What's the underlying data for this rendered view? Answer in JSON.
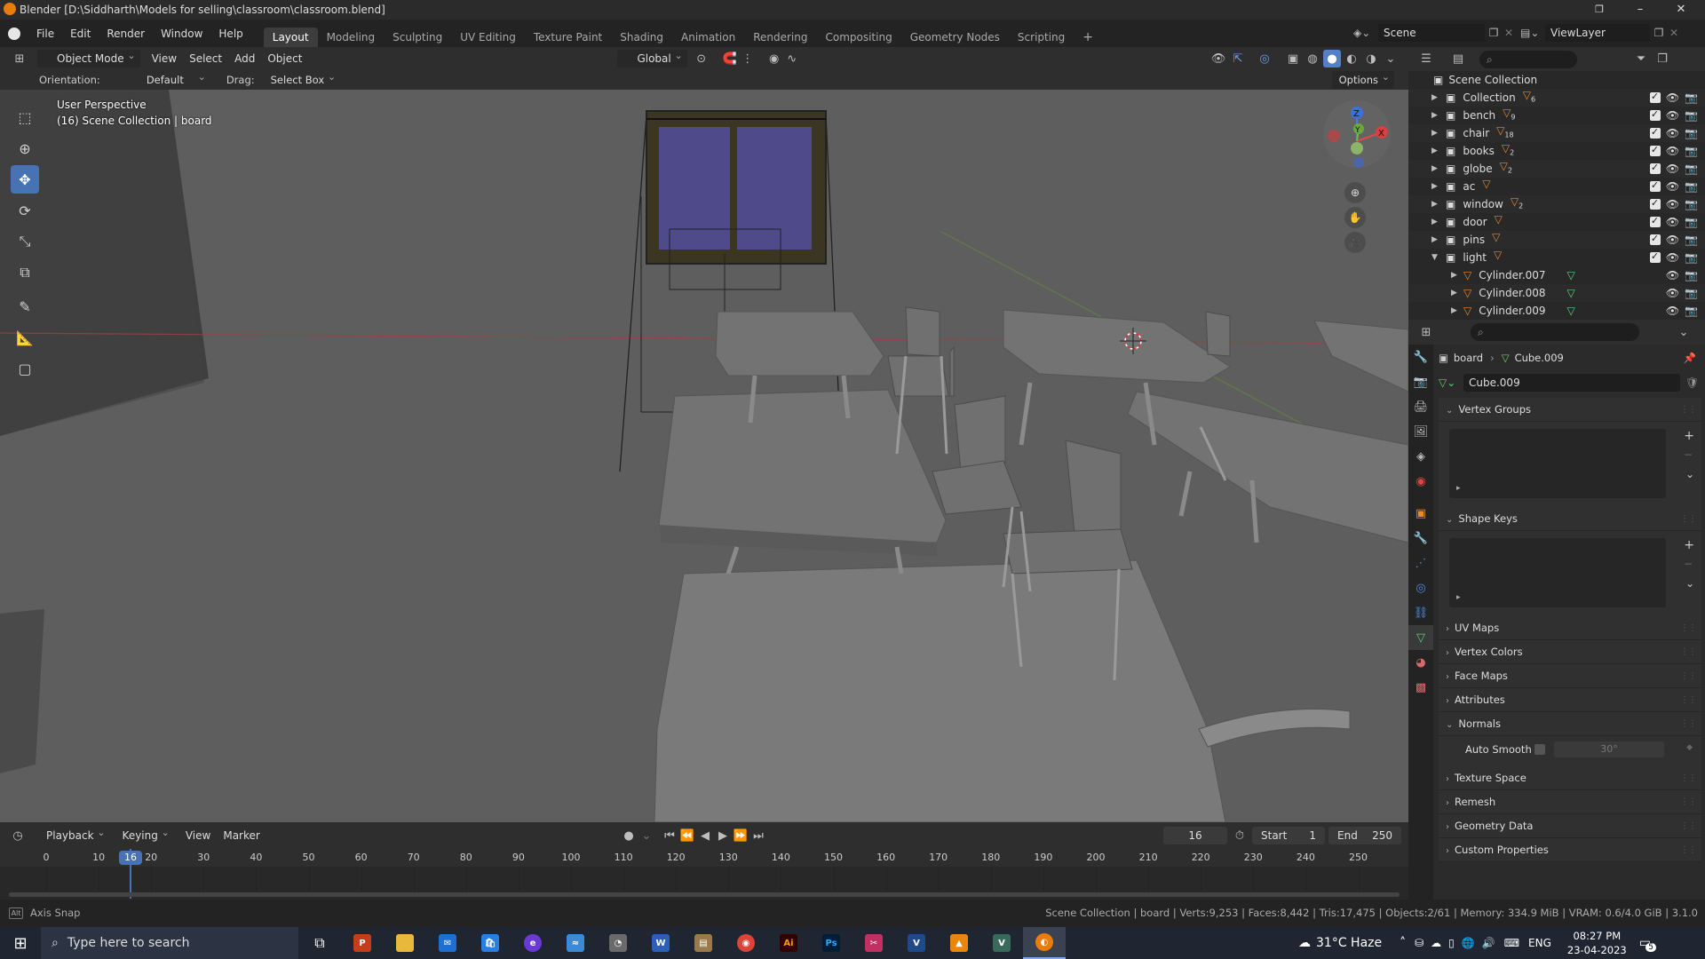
{
  "window": {
    "title": "Blender [D:\\Siddharth\\Models for selling\\classroom\\classroom.blend]",
    "minimize": "–",
    "maximize": "❐",
    "close": "✕"
  },
  "menu": {
    "items": [
      "File",
      "Edit",
      "Render",
      "Window",
      "Help"
    ]
  },
  "workspaces": [
    "Layout",
    "Modeling",
    "Sculpting",
    "UV Editing",
    "Texture Paint",
    "Shading",
    "Animation",
    "Rendering",
    "Compositing",
    "Geometry Nodes",
    "Scripting"
  ],
  "workspace_add": "+",
  "scene_field": "Scene",
  "viewlayer_field": "ViewLayer",
  "viewport_header": {
    "mode": "Object Mode",
    "menus": [
      "View",
      "Select",
      "Add",
      "Object"
    ],
    "transform": "Global",
    "options": "Options"
  },
  "tool_header": {
    "orientation_label": "Orientation:",
    "orientation_value": "Default",
    "drag_label": "Drag:",
    "drag_value": "Select Box"
  },
  "viewport": {
    "perspective": "User Perspective",
    "context": "(16) Scene Collection | board"
  },
  "gizmo": {
    "z": "Z",
    "y": "Y",
    "x": "X"
  },
  "outliner": {
    "root": "Scene Collection",
    "items": [
      {
        "name": "Collection",
        "count": "6"
      },
      {
        "name": "bench",
        "count": "9"
      },
      {
        "name": "chair",
        "count": "18"
      },
      {
        "name": "books",
        "count": "2"
      },
      {
        "name": "globe",
        "count": "2"
      },
      {
        "name": "ac",
        "count": ""
      },
      {
        "name": "window",
        "count": "2"
      },
      {
        "name": "door",
        "count": ""
      },
      {
        "name": "pins",
        "count": ""
      },
      {
        "name": "light",
        "count": ""
      }
    ],
    "children": [
      "Cylinder.007",
      "Cylinder.008",
      "Cylinder.009"
    ]
  },
  "properties": {
    "breadcrumb_object": "board",
    "breadcrumb_mesh": "Cube.009",
    "mesh_name": "Cube.009",
    "panels_top": [
      "Vertex Groups",
      "Shape Keys"
    ],
    "panels_collapsed": [
      "UV Maps",
      "Vertex Colors",
      "Face Maps",
      "Attributes"
    ],
    "normals": {
      "title": "Normals",
      "auto_smooth_label": "Auto Smooth",
      "angle": "30°"
    },
    "panels_bottom": [
      "Texture Space",
      "Remesh",
      "Geometry Data",
      "Custom Properties"
    ]
  },
  "timeline": {
    "menus": [
      "Playback",
      "Keying",
      "View",
      "Marker"
    ],
    "current_frame": "16",
    "start_label": "Start",
    "start": "1",
    "end_label": "End",
    "end": "250",
    "ticks": [
      "0",
      "10",
      "20",
      "30",
      "40",
      "50",
      "60",
      "70",
      "80",
      "90",
      "100",
      "110",
      "120",
      "130",
      "140",
      "150",
      "160",
      "170",
      "180",
      "190",
      "200",
      "210",
      "220",
      "230",
      "240",
      "250"
    ]
  },
  "statusbar": {
    "left": "Axis Snap",
    "right": "Scene Collection | board | Verts:9,253 | Faces:8,442 | Tris:17,475 | Objects:2/61 | Memory: 334.9 MiB | VRAM: 0.6/4.0 GiB | 3.1.0"
  },
  "taskbar": {
    "search_placeholder": "Type here to search",
    "weather": "31°C  Haze",
    "language": "ENG",
    "time": "08:27 PM",
    "date": "23-04-2023",
    "notification_count": "5"
  }
}
